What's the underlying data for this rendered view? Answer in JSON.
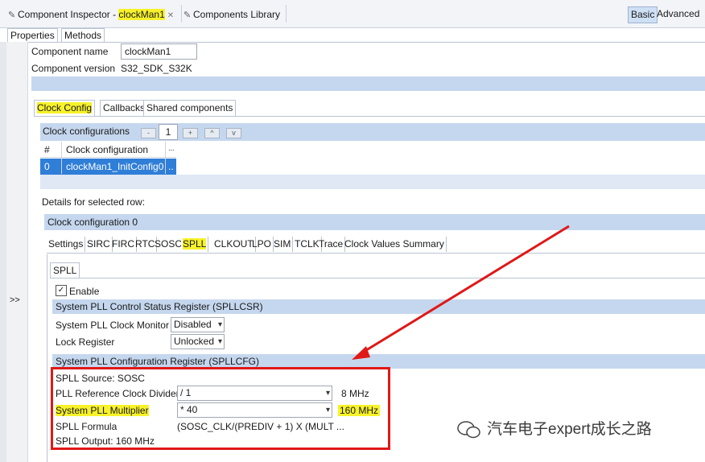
{
  "window": {
    "tab1_prefix": "Component Inspector - ",
    "tab1_component": "clockMan1",
    "tab1_close": "✕",
    "tab2_label": "Components Library",
    "mode_basic": "Basic",
    "mode_advanced": "Advanced"
  },
  "subtabs": {
    "properties": "Properties",
    "methods": "Methods"
  },
  "collapse_label": ">>",
  "general": {
    "component_name_label": "Component name",
    "component_name_value": "clockMan1",
    "component_version_label": "Component version",
    "component_version_value": "S32_SDK_S32K"
  },
  "config_tabs": [
    "Clock Config",
    "Callbacks",
    "Shared components"
  ],
  "clock_configurations": {
    "title": "Clock configurations",
    "minus": "-",
    "count": "1",
    "plus": "+",
    "up": "^",
    "down": "v",
    "col_index": "#",
    "col_name": "Clock configuration",
    "col_more": "...",
    "row_index": "0",
    "row_name": "clockMan1_InitConfig0",
    "row_more": ".."
  },
  "details": {
    "label": "Details for selected row:",
    "group_title": "Clock configuration 0"
  },
  "feature_tabs": [
    "Settings",
    "SIRC",
    "FIRC",
    "RTC",
    "SOSC",
    "SPLL",
    "CLKOUT",
    "LPO",
    "SIM",
    "TCLK",
    "Trace",
    "Clock Values Summary"
  ],
  "spll": {
    "panel_title": "SPLL",
    "enable_label": "Enable",
    "enable_checked": true,
    "check_glyph": "✓",
    "csr_title": "System PLL Control Status Register (SPLLCSR)",
    "clock_monitor_label": "System PLL Clock Monitor",
    "clock_monitor_value": "Disabled",
    "lock_register_label": "Lock Register",
    "lock_register_value": "Unlocked",
    "cfg_title": "System PLL Configuration Register (SPLLCFG)",
    "source_text": "SPLL Source: SOSC",
    "ref_divider_label": "PLL Reference Clock Divider",
    "ref_divider_value": "/ 1",
    "ref_divider_freq": "8 MHz",
    "multiplier_label": "System PLL Multiplier",
    "multiplier_value": "* 40",
    "multiplier_freq": "160 MHz",
    "formula_label": "SPLL Formula",
    "formula_value": "(SOSC_CLK/(PREDIV + 1) X (MULT ...",
    "output_text": "SPLL Output: 160 MHz"
  },
  "watermark": "汽车电子expert成长之路",
  "colors": {
    "highlight": "#f7f22a",
    "annotation_red": "#e01818",
    "selection_blue": "#2f7ed8",
    "section_blue": "#c5d7ee"
  }
}
